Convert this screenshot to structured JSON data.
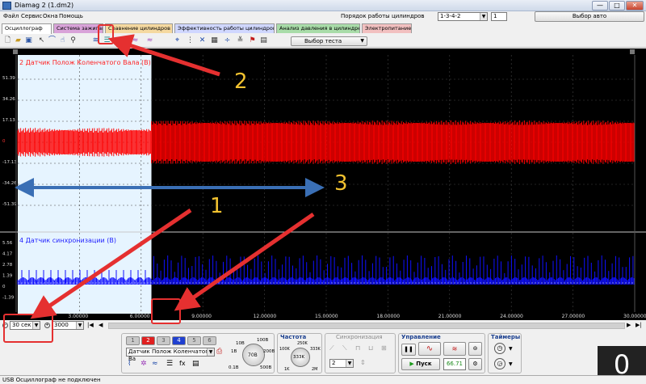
{
  "window": {
    "title": "Diamag 2 (1.dm2)",
    "controls": [
      "—",
      "□",
      "✕"
    ]
  },
  "menu": {
    "items": [
      "Файл",
      "Сервис",
      "Окна",
      "Помощь"
    ]
  },
  "firing_order": {
    "label": "Порядок работы цилиндров",
    "value": "1-3-4-2",
    "spin": "1"
  },
  "select_auto_label": "Выбор авто",
  "tabs": [
    {
      "label": "Осциллограф",
      "color": "#ffffff"
    },
    {
      "label": "Система зажигания",
      "color": "#d9a3d9"
    },
    {
      "label": "Сравнение цилиндров",
      "color": "#f5d9a0"
    },
    {
      "label": "Эффективность работы цилиндров",
      "color": "#d0d7ff"
    },
    {
      "label": "Анализ давления в цилиндре",
      "color": "#a9dca9"
    },
    {
      "label": "Электропитание",
      "color": "#f2c0c0"
    }
  ],
  "toolbar": {
    "icons": [
      "new-file",
      "open-file",
      "save-file",
      "cursor",
      "measure",
      "hand",
      "zoom",
      "signal-overlay",
      "signal-split",
      "channels-a",
      "channels-b",
      "marker",
      "grid",
      "table",
      "split",
      "flag",
      "notes"
    ],
    "test_select_label": "Выбор теста"
  },
  "scope": {
    "channel1": {
      "title": "2 Датчик Полож Коленчатого Вала (B)",
      "y_ticks": [
        "51.39",
        "34.26",
        "17.13",
        "0",
        "-17.13",
        "-34.26",
        "-51.39"
      ],
      "color": "#ff0000"
    },
    "channel2": {
      "title": "4 Датчик синхронизации (B)",
      "y_ticks": [
        "5.56",
        "4.17",
        "2.78",
        "1.39",
        "0",
        "-1.39"
      ],
      "color": "#1010ff"
    },
    "x_ticks": [
      "3.00000",
      "6.00000",
      "9.00000",
      "12.00000",
      "15.00000",
      "18.00000",
      "21.00000",
      "24.00000",
      "27.00000",
      "30.00000"
    ],
    "x_max": 30,
    "highlight_end": 6.5
  },
  "scrollbar": {
    "timebase": "30 сек",
    "samples": "3000"
  },
  "channels_panel": {
    "buttons": [
      "1",
      "2",
      "3",
      "4",
      "5",
      "6"
    ],
    "active": "2",
    "channel_name": "Датчик Полож Коленчатого Ва"
  },
  "voltage": {
    "labels": [
      "1В",
      "10В",
      "100В",
      "200В",
      "500В",
      "0.1В",
      "70В"
    ],
    "current": "70В"
  },
  "frequency": {
    "title": "Частота",
    "labels": [
      "100K",
      "250K",
      "333K",
      "1K",
      "2M"
    ],
    "current": "333K"
  },
  "sync": {
    "title": "Синхронизация",
    "value": "2"
  },
  "control": {
    "title": "Управление",
    "start_label": "Пуск",
    "value": "66.71"
  },
  "timers": {
    "title": "Таймеры"
  },
  "counter": "0",
  "status": "USB Осциллограф не подключен",
  "annotations": [
    "1",
    "2",
    "3"
  ]
}
